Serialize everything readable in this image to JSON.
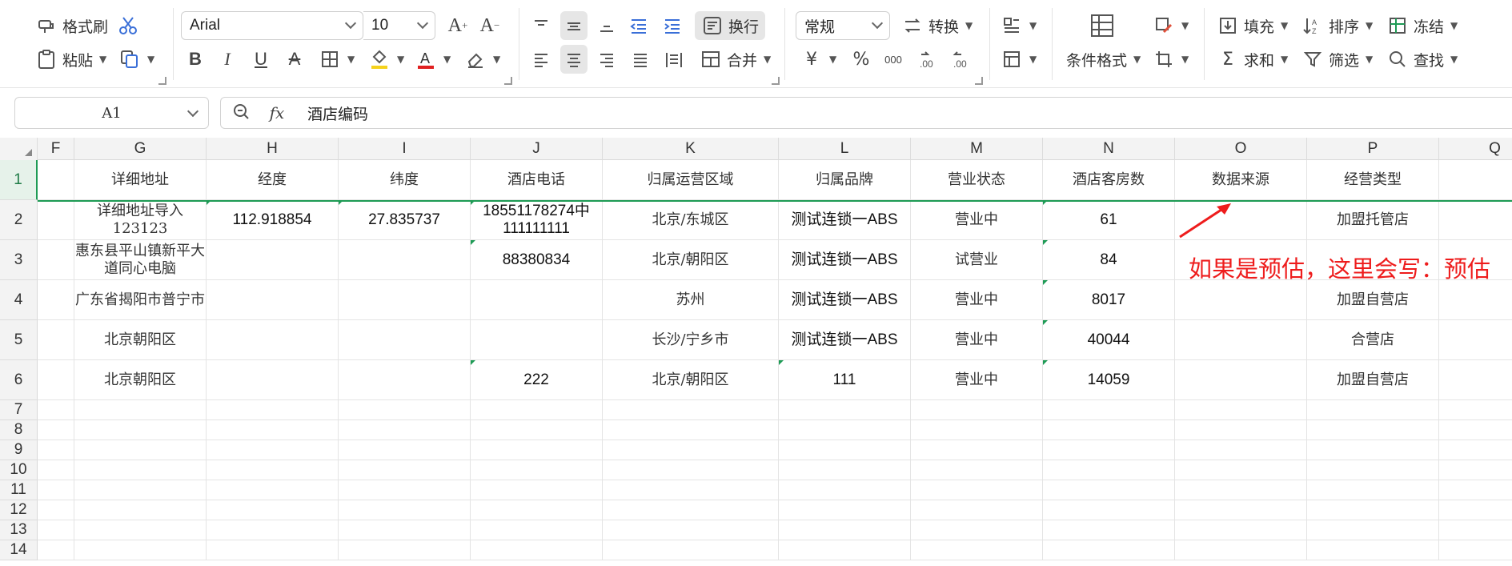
{
  "toolbar": {
    "format_painter": "格式刷",
    "paste": "粘贴",
    "font_name": "Arial",
    "font_size": "10",
    "wrap_text": "换行",
    "merge": "合并",
    "number_format": "常规",
    "convert": "转换",
    "conditional_format": "条件格式",
    "fill": "填充",
    "sort": "排序",
    "freeze": "冻结",
    "sum": "求和",
    "filter": "筛选",
    "find": "查找",
    "currency_symbol": "¥",
    "percent_symbol": "%",
    "thousands_symbol": "000"
  },
  "colors": {
    "accent": "#1e9b55",
    "font_color_bar": "#e02020",
    "highlight_bar": "#f5d21c",
    "annotation": "#ee1c1c"
  },
  "formula_bar": {
    "name_box": "A1",
    "fx": "fx",
    "value": "酒店编码"
  },
  "grid": {
    "columns": [
      "F",
      "G",
      "H",
      "I",
      "J",
      "K",
      "L",
      "M",
      "N",
      "O",
      "P",
      "Q"
    ],
    "rows": [
      "1",
      "2",
      "3",
      "4",
      "5",
      "6",
      "7",
      "8",
      "9",
      "10",
      "11",
      "12",
      "13",
      "14"
    ],
    "header_cells": [
      "",
      "详细地址",
      "经度",
      "纬度",
      "酒店电话",
      "归属运营区域",
      "归属品牌",
      "营业状态",
      "酒店客房数",
      "数据来源",
      "经营类型",
      ""
    ],
    "data_rows": [
      [
        "",
        "详细地址导入123123",
        "112.918854",
        "27.835737",
        "18551178274中111111111",
        "北京/东城区",
        "测试连锁一ABS",
        "营业中",
        "61",
        "",
        "加盟托管店",
        ""
      ],
      [
        "",
        "惠东县平山镇新平大道同心电脑",
        "",
        "",
        "88380834",
        "北京/朝阳区",
        "测试连锁一ABS",
        "试营业",
        "84",
        "",
        "",
        ""
      ],
      [
        "",
        "广东省揭阳市普宁市",
        "",
        "",
        "",
        "苏州",
        "测试连锁一ABS",
        "营业中",
        "8017",
        "",
        "加盟自营店",
        ""
      ],
      [
        "",
        "北京朝阳区",
        "",
        "",
        "",
        "长沙/宁乡市",
        "测试连锁一ABS",
        "营业中",
        "40044",
        "",
        "合营店",
        ""
      ],
      [
        "",
        "北京朝阳区",
        "",
        "",
        "222",
        "北京/朝阳区",
        "111",
        "营业中",
        "14059",
        "",
        "加盟自营店",
        ""
      ]
    ]
  },
  "annotation": {
    "text": "如果是预估，这里会写：预估"
  }
}
